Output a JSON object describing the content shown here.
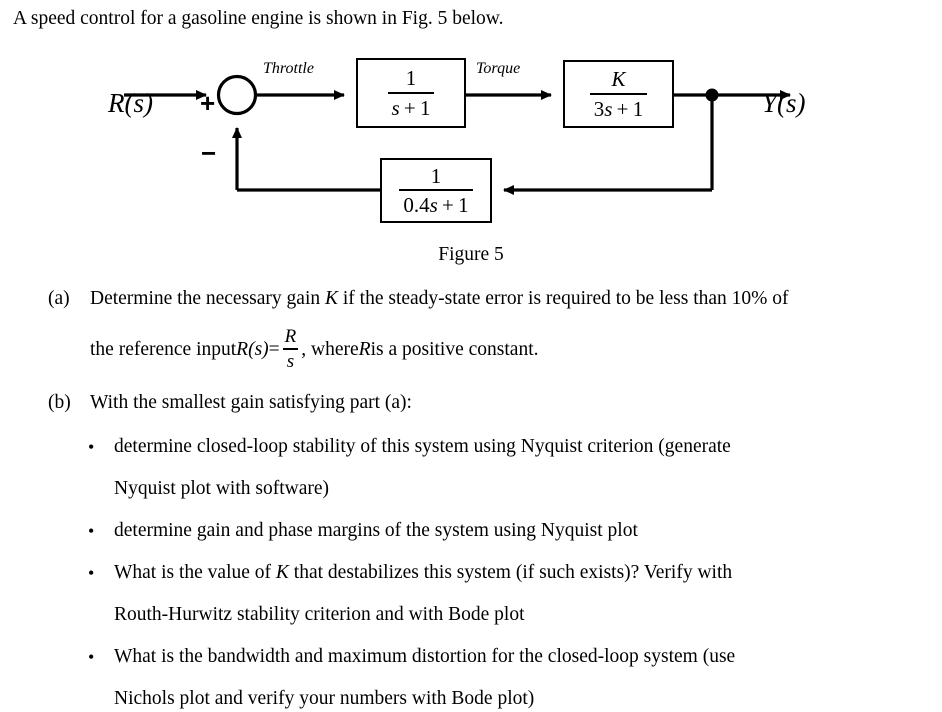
{
  "document": {
    "intro": "A speed control for a gasoline engine is shown in Fig. 5 below.",
    "figure_caption": "Figure 5"
  },
  "diagram": {
    "input_label": "R(s)",
    "output_label": "Y(s)",
    "plus_sign": "+",
    "minus_sign": "−",
    "signal_labels": {
      "throttle": "Throttle",
      "torque": "Torque"
    },
    "blocks": [
      {
        "name": "throttle-actuator",
        "numerator": "1",
        "denominator": "s + 1",
        "denominator_var": "s",
        "denominator_rest": " + 1"
      },
      {
        "name": "engine-gain",
        "numerator": "K",
        "denominator": "3s + 1",
        "denominator_prefix": "3",
        "denominator_var": "s",
        "denominator_rest": " + 1"
      },
      {
        "name": "feedback-sensor",
        "numerator": "1",
        "denominator": "0.4s + 1",
        "denominator_prefix": "0.4",
        "denominator_var": "s",
        "denominator_rest": " + 1"
      }
    ]
  },
  "questions": {
    "a": {
      "marker": "(a)",
      "line1_part1": "Determine the necessary gain ",
      "line1_var": "K",
      "line1_part2": " if the steady-state error is required to be less than 10% of",
      "line2_part1": "the reference input  ",
      "line2_rs": "R(s)",
      "line2_eq": " = ",
      "line2_frac_num": "R",
      "line2_frac_den": "s",
      "line2_part2": ", where ",
      "line2_var": "R",
      "line2_part3": " is a positive constant."
    },
    "b": {
      "marker": "(b)",
      "heading": "With the smallest gain satisfying part (a):",
      "bullet_glyph": "•",
      "bullets": [
        {
          "line1": "determine closed-loop stability of this system using Nyquist criterion (generate",
          "line2": "Nyquist plot with software)"
        },
        {
          "line1": "determine gain and phase margins of the system using Nyquist plot",
          "line2": ""
        },
        {
          "line1_part1": "What is the value of ",
          "line1_var": "K",
          "line1_part2": " that destabilizes this system (if such exists)? Verify with",
          "line2": "Routh-Hurwitz stability criterion and with Bode plot"
        },
        {
          "line1": "What is the bandwidth and maximum distortion for the closed-loop system (use",
          "line2": "Nichols plot and verify your numbers with Bode plot)"
        }
      ]
    }
  },
  "colors": {
    "ink": "#000000",
    "paper": "#ffffff"
  }
}
